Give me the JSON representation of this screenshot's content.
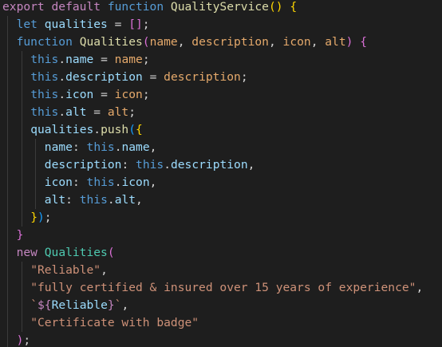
{
  "editor": {
    "colors": {
      "background": "#1e1e1e",
      "keyword": "#c586c0",
      "storage": "#569cd6",
      "function_name": "#dcdcaa",
      "class_name": "#4ec9b0",
      "variable": "#9cdcfe",
      "parameter": "#e5a96b",
      "this": "#569cd6",
      "string": "#ce9178",
      "punctuation": "#d4d4d4",
      "bracket_1": "#ffd700",
      "bracket_2": "#da70d6",
      "bracket_3": "#179fff",
      "indent_guide": "#3b3b3b"
    },
    "lines": [
      {
        "indent": 0,
        "tokens": [
          {
            "t": "export",
            "c": "keyword"
          },
          {
            "t": " ",
            "c": "punctuation"
          },
          {
            "t": "default",
            "c": "keyword"
          },
          {
            "t": " ",
            "c": "punctuation"
          },
          {
            "t": "function",
            "c": "storage"
          },
          {
            "t": " ",
            "c": "punctuation"
          },
          {
            "t": "QualityService",
            "c": "function_name"
          },
          {
            "t": "()",
            "c": "bracket_1"
          },
          {
            "t": " ",
            "c": "punctuation"
          },
          {
            "t": "{",
            "c": "bracket_1"
          }
        ]
      },
      {
        "indent": 1,
        "tokens": [
          {
            "t": "let",
            "c": "storage"
          },
          {
            "t": " ",
            "c": "punctuation"
          },
          {
            "t": "qualities",
            "c": "variable"
          },
          {
            "t": " = ",
            "c": "punctuation"
          },
          {
            "t": "[]",
            "c": "bracket_2"
          },
          {
            "t": ";",
            "c": "punctuation"
          }
        ]
      },
      {
        "indent": 1,
        "tokens": [
          {
            "t": "function",
            "c": "storage"
          },
          {
            "t": " ",
            "c": "punctuation"
          },
          {
            "t": "Qualities",
            "c": "function_name"
          },
          {
            "t": "(",
            "c": "bracket_2"
          },
          {
            "t": "name",
            "c": "parameter"
          },
          {
            "t": ", ",
            "c": "punctuation"
          },
          {
            "t": "description",
            "c": "parameter"
          },
          {
            "t": ", ",
            "c": "punctuation"
          },
          {
            "t": "icon",
            "c": "parameter"
          },
          {
            "t": ", ",
            "c": "punctuation"
          },
          {
            "t": "alt",
            "c": "parameter"
          },
          {
            "t": ")",
            "c": "bracket_2"
          },
          {
            "t": " ",
            "c": "punctuation"
          },
          {
            "t": "{",
            "c": "bracket_2"
          }
        ]
      },
      {
        "indent": 2,
        "tokens": [
          {
            "t": "this",
            "c": "this"
          },
          {
            "t": ".",
            "c": "punctuation"
          },
          {
            "t": "name",
            "c": "variable"
          },
          {
            "t": " = ",
            "c": "punctuation"
          },
          {
            "t": "name",
            "c": "parameter"
          },
          {
            "t": ";",
            "c": "punctuation"
          }
        ]
      },
      {
        "indent": 2,
        "tokens": [
          {
            "t": "this",
            "c": "this"
          },
          {
            "t": ".",
            "c": "punctuation"
          },
          {
            "t": "description",
            "c": "variable"
          },
          {
            "t": " = ",
            "c": "punctuation"
          },
          {
            "t": "description",
            "c": "parameter"
          },
          {
            "t": ";",
            "c": "punctuation"
          }
        ]
      },
      {
        "indent": 2,
        "tokens": [
          {
            "t": "this",
            "c": "this"
          },
          {
            "t": ".",
            "c": "punctuation"
          },
          {
            "t": "icon",
            "c": "variable"
          },
          {
            "t": " = ",
            "c": "punctuation"
          },
          {
            "t": "icon",
            "c": "parameter"
          },
          {
            "t": ";",
            "c": "punctuation"
          }
        ]
      },
      {
        "indent": 2,
        "tokens": [
          {
            "t": "this",
            "c": "this"
          },
          {
            "t": ".",
            "c": "punctuation"
          },
          {
            "t": "alt",
            "c": "variable"
          },
          {
            "t": " = ",
            "c": "punctuation"
          },
          {
            "t": "alt",
            "c": "parameter"
          },
          {
            "t": ";",
            "c": "punctuation"
          }
        ]
      },
      {
        "indent": 2,
        "tokens": [
          {
            "t": "qualities",
            "c": "variable"
          },
          {
            "t": ".",
            "c": "punctuation"
          },
          {
            "t": "push",
            "c": "function_name"
          },
          {
            "t": "(",
            "c": "bracket_3"
          },
          {
            "t": "{",
            "c": "bracket_1"
          }
        ]
      },
      {
        "indent": 3,
        "tokens": [
          {
            "t": "name",
            "c": "variable"
          },
          {
            "t": ": ",
            "c": "punctuation"
          },
          {
            "t": "this",
            "c": "this"
          },
          {
            "t": ".",
            "c": "punctuation"
          },
          {
            "t": "name",
            "c": "variable"
          },
          {
            "t": ",",
            "c": "punctuation"
          }
        ]
      },
      {
        "indent": 3,
        "tokens": [
          {
            "t": "description",
            "c": "variable"
          },
          {
            "t": ": ",
            "c": "punctuation"
          },
          {
            "t": "this",
            "c": "this"
          },
          {
            "t": ".",
            "c": "punctuation"
          },
          {
            "t": "description",
            "c": "variable"
          },
          {
            "t": ",",
            "c": "punctuation"
          }
        ]
      },
      {
        "indent": 3,
        "tokens": [
          {
            "t": "icon",
            "c": "variable"
          },
          {
            "t": ": ",
            "c": "punctuation"
          },
          {
            "t": "this",
            "c": "this"
          },
          {
            "t": ".",
            "c": "punctuation"
          },
          {
            "t": "icon",
            "c": "variable"
          },
          {
            "t": ",",
            "c": "punctuation"
          }
        ]
      },
      {
        "indent": 3,
        "tokens": [
          {
            "t": "alt",
            "c": "variable"
          },
          {
            "t": ": ",
            "c": "punctuation"
          },
          {
            "t": "this",
            "c": "this"
          },
          {
            "t": ".",
            "c": "punctuation"
          },
          {
            "t": "alt",
            "c": "variable"
          },
          {
            "t": ",",
            "c": "punctuation"
          }
        ]
      },
      {
        "indent": 2,
        "tokens": [
          {
            "t": "}",
            "c": "bracket_1"
          },
          {
            "t": ")",
            "c": "bracket_3"
          },
          {
            "t": ";",
            "c": "punctuation"
          }
        ]
      },
      {
        "indent": 1,
        "tokens": [
          {
            "t": "}",
            "c": "bracket_2"
          }
        ]
      },
      {
        "indent": 1,
        "tokens": [
          {
            "t": "new",
            "c": "keyword"
          },
          {
            "t": " ",
            "c": "punctuation"
          },
          {
            "t": "Qualities",
            "c": "class_name"
          },
          {
            "t": "(",
            "c": "bracket_2"
          }
        ]
      },
      {
        "indent": 2,
        "tokens": [
          {
            "t": "\"Reliable\"",
            "c": "string"
          },
          {
            "t": ",",
            "c": "punctuation"
          }
        ]
      },
      {
        "indent": 2,
        "tokens": [
          {
            "t": "\"fully certified & insured over 15 years of experience\"",
            "c": "string"
          },
          {
            "t": ",",
            "c": "punctuation"
          }
        ]
      },
      {
        "indent": 2,
        "tokens": [
          {
            "t": "`",
            "c": "string"
          },
          {
            "t": "${",
            "c": "keyword"
          },
          {
            "t": "Reliable",
            "c": "variable"
          },
          {
            "t": "}",
            "c": "keyword"
          },
          {
            "t": "`",
            "c": "string"
          },
          {
            "t": ",",
            "c": "punctuation"
          }
        ]
      },
      {
        "indent": 2,
        "tokens": [
          {
            "t": "\"Certificate with badge\"",
            "c": "string"
          }
        ]
      },
      {
        "indent": 1,
        "tokens": [
          {
            "t": ")",
            "c": "bracket_2"
          },
          {
            "t": ";",
            "c": "punctuation"
          }
        ]
      }
    ]
  }
}
